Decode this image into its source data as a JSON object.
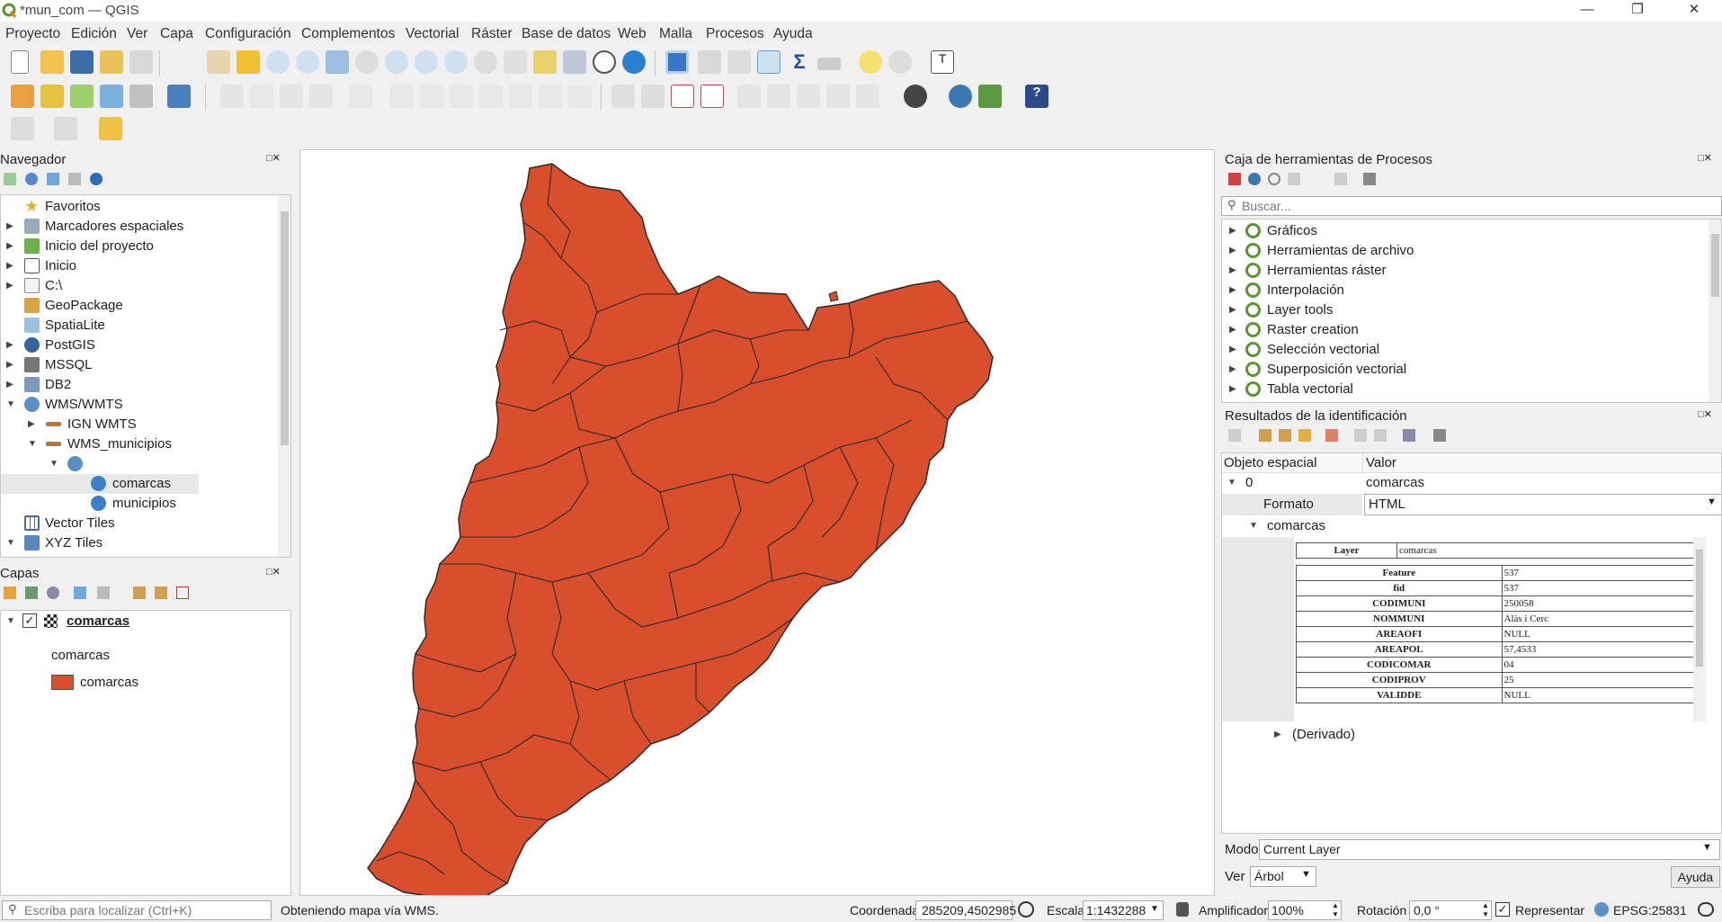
{
  "window": {
    "title": "*mun_com — QGIS"
  },
  "menu": [
    "Proyecto",
    "Edición",
    "Ver",
    "Capa",
    "Configuración",
    "Complementos",
    "Vectorial",
    "Ráster",
    "Base de datos",
    "Web",
    "Malla",
    "Procesos",
    "Ayuda"
  ],
  "browser": {
    "title": "Navegador",
    "items": [
      {
        "label": "Favoritos",
        "icon": "star-icon"
      },
      {
        "label": "Marcadores espaciales",
        "icon": "bookmark-icon"
      },
      {
        "label": "Inicio del proyecto",
        "icon": "project-home-icon"
      },
      {
        "label": "Inicio",
        "icon": "home-icon"
      },
      {
        "label": "C:\\",
        "icon": "folder-icon"
      },
      {
        "label": "GeoPackage",
        "icon": "geopackage-icon"
      },
      {
        "label": "SpatiaLite",
        "icon": "spatialite-icon"
      },
      {
        "label": "PostGIS",
        "icon": "postgis-icon"
      },
      {
        "label": "MSSQL",
        "icon": "mssql-icon"
      },
      {
        "label": "DB2",
        "icon": "db2-icon"
      },
      {
        "label": "WMS/WMTS",
        "icon": "globe-icon"
      },
      {
        "label": "IGN WMTS",
        "icon": "wms-connection-icon"
      },
      {
        "label": "WMS_municipios",
        "icon": "wms-connection-icon"
      },
      {
        "label": "",
        "icon": "globe-icon"
      },
      {
        "label": "comarcas",
        "icon": "globe-icon"
      },
      {
        "label": "municipios",
        "icon": "globe-icon"
      },
      {
        "label": "Vector Tiles",
        "icon": "vector-tiles-icon"
      },
      {
        "label": "XYZ Tiles",
        "icon": "xyz-tiles-icon"
      }
    ]
  },
  "layers": {
    "title": "Capas",
    "layer_name": "comarcas",
    "legend_title": "comarcas",
    "legend_item": "comarcas",
    "legend_color": "#d94f2e"
  },
  "map": {
    "fill": "#d94f2e",
    "stroke": "#2a2a2a"
  },
  "processing": {
    "title": "Caja de herramientas de Procesos",
    "search_placeholder": "Buscar...",
    "items": [
      "Gráficos",
      "Herramientas de archivo",
      "Herramientas ráster",
      "Interpolación",
      "Layer tools",
      "Raster creation",
      "Selección vectorial",
      "Superposición vectorial",
      "Tabla vectorial"
    ]
  },
  "identify": {
    "title": "Resultados de la identificación",
    "col_feature": "Objeto espacial",
    "col_value": "Valor",
    "row0_key": "0",
    "row0_val": "comarcas",
    "format_label": "Formato",
    "format_value": "HTML",
    "sub_label": "comarcas",
    "layer_key": "Layer",
    "layer_val": "comarcas",
    "attrs": [
      {
        "k": "Feature",
        "v": "537"
      },
      {
        "k": "fid",
        "v": "537"
      },
      {
        "k": "CODIMUNI",
        "v": "250058"
      },
      {
        "k": "NOMMUNI",
        "v": "Alàs i Cerc"
      },
      {
        "k": "AREAOFI",
        "v": "NULL"
      },
      {
        "k": "AREAPOL",
        "v": "57,4533"
      },
      {
        "k": "CODICOMAR",
        "v": "04"
      },
      {
        "k": "CODIPROV",
        "v": "25"
      },
      {
        "k": "VALIDDE",
        "v": "NULL"
      }
    ],
    "derived": "(Derivado)",
    "mode_label": "Modo",
    "mode_value": "Current Layer",
    "view_label": "Ver",
    "view_value": "Árbol",
    "help_button": "Ayuda"
  },
  "status": {
    "locator_placeholder": "Escriba para localizar (Ctrl+K)",
    "message": "Obteniendo mapa vía WMS.",
    "coord_label": "Coordenada",
    "coord_value": "285209,4502985",
    "scale_label": "Escala",
    "scale_value": "1:1432288",
    "magnifier_label": "Amplificador",
    "magnifier_value": "100%",
    "rotation_label": "Rotación",
    "rotation_value": "0,0 °",
    "render_label": "Representar",
    "crs": "EPSG:25831"
  }
}
